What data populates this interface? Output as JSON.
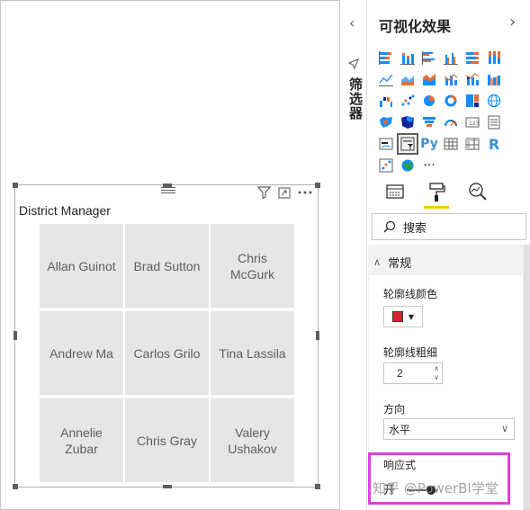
{
  "filters_pane": {
    "label": "筛选器",
    "collapse_icon": "chevron-left-icon"
  },
  "visualizations_pane": {
    "title": "可视化效果",
    "expand_icon": "chevron-right-icon",
    "visual_types": [
      "stacked-bar",
      "stacked-column",
      "clustered-bar",
      "clustered-column",
      "100-stacked-bar",
      "100-stacked-column",
      "line",
      "area",
      "stacked-area",
      "line-clustered-column",
      "line-stacked-column",
      "ribbon",
      "waterfall",
      "scatter",
      "pie",
      "donut",
      "treemap",
      "map",
      "filled-map",
      "shape-map",
      "funnel",
      "gauge",
      "card",
      "multi-row-card",
      "kpi",
      "slicer",
      "python-visual",
      "table",
      "matrix",
      "r-visual",
      "key-influencers",
      "arcgis-map",
      "more"
    ],
    "selected_visual": "slicer",
    "visual_glyphs": {
      "python": "Py",
      "r": "R",
      "more": "···"
    },
    "tabs": [
      "fields",
      "format",
      "analytics"
    ],
    "active_tab": "format",
    "search": {
      "label": "搜索"
    },
    "section": {
      "title": "常规"
    },
    "outline_color": {
      "label": "轮廓线颜色",
      "value": "#d6232b"
    },
    "outline_weight": {
      "label": "轮廓线粗细",
      "value": "2"
    },
    "orientation": {
      "label": "方向",
      "value": "水平"
    },
    "responsive": {
      "label": "响应式",
      "toggle_label": "开",
      "state": "on"
    }
  },
  "slicer_visual": {
    "title": "District Manager",
    "header_icons": [
      "filter-icon",
      "focus-mode-icon",
      "more-options-icon"
    ],
    "tiles": [
      "Allan Guinot",
      "Brad Sutton",
      "Chris McGurk",
      "Andrew Ma",
      "Carlos Grilo",
      "Tina Lassila",
      "Annelie Zubar",
      "Chris Gray",
      "Valery Ushakov"
    ]
  },
  "watermark": "知乎 @PowerBI学堂",
  "colors": {
    "highlight": "#e23de0",
    "format_tab_accent": "#f2c811",
    "tile_bg": "#e6e6e6",
    "pane_bg": "#f3f2f1"
  }
}
